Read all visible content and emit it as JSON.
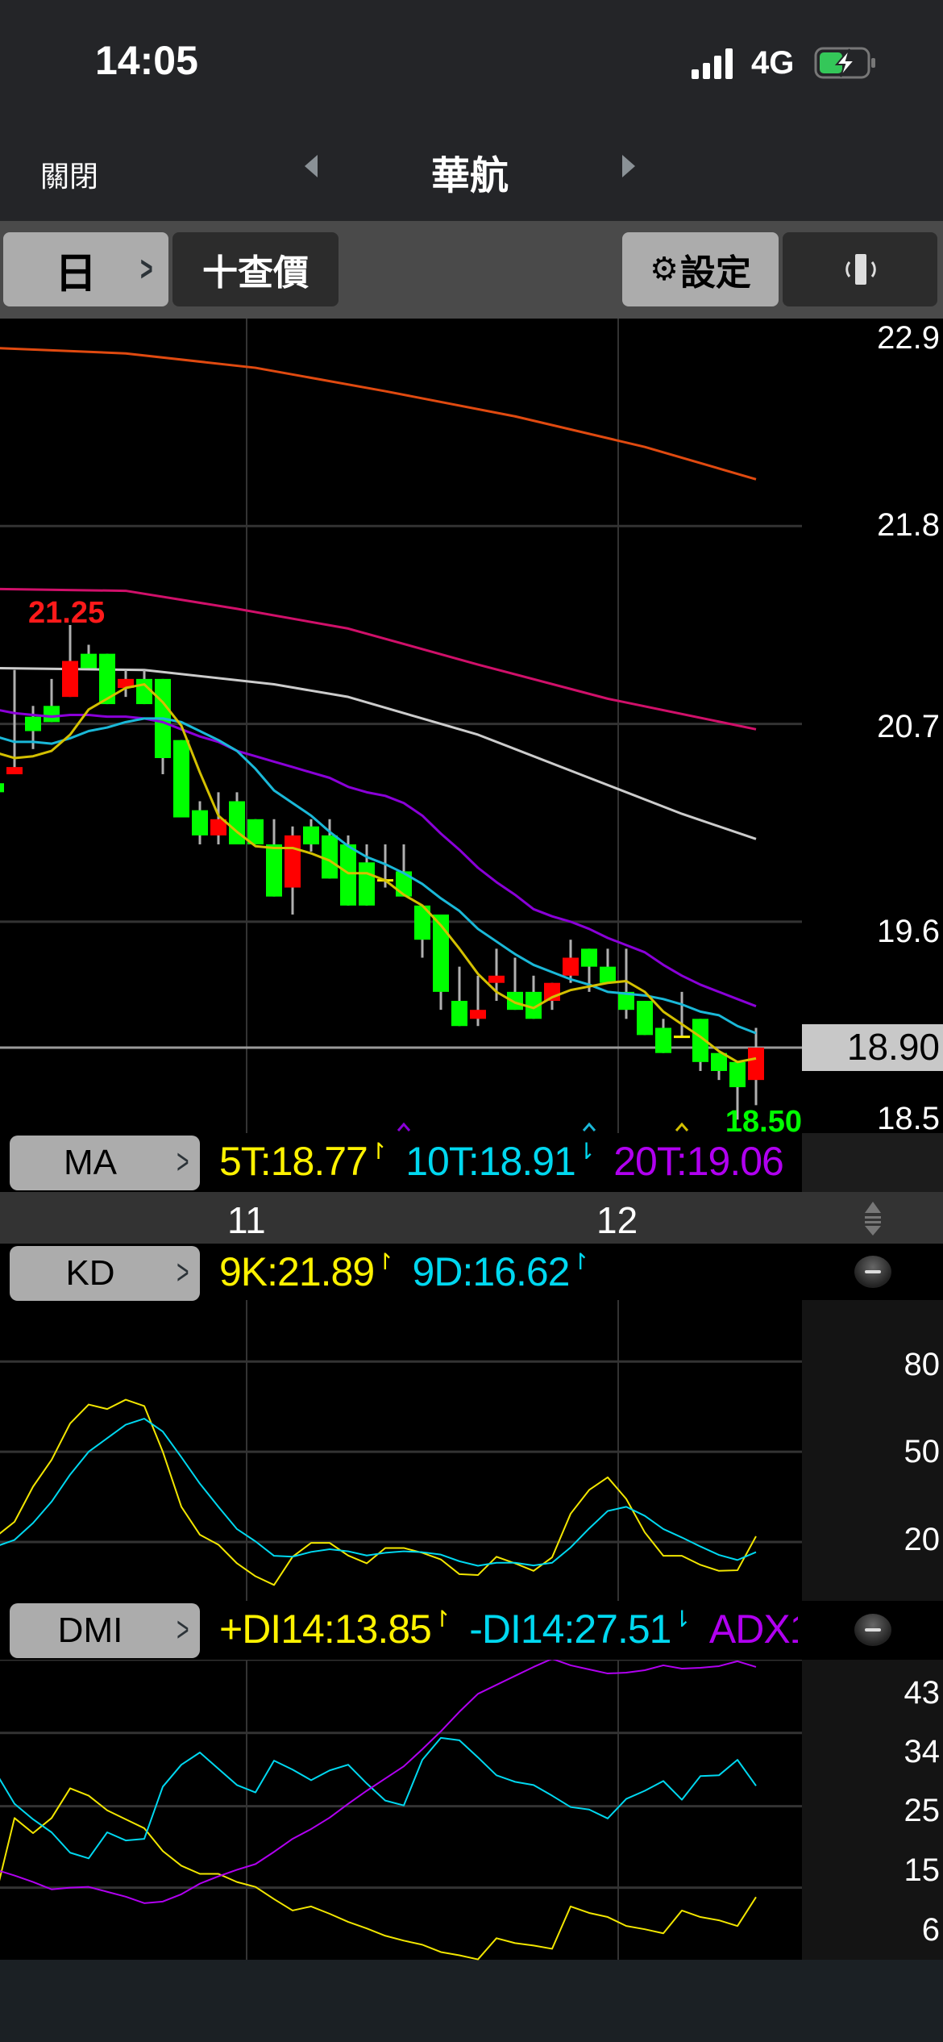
{
  "status_bar": {
    "time": "14:05",
    "network": "4G"
  },
  "nav": {
    "close": "關閉",
    "title": "華航"
  },
  "toolbar": {
    "period": "日",
    "quote": "十查價",
    "settings": "設定"
  },
  "price_axis": {
    "labels": [
      "22.9",
      "21.8",
      "20.7",
      "19.6",
      "18.5"
    ],
    "current": "18.90",
    "high_label": "21.25",
    "low_label": "18.50"
  },
  "ma_row": {
    "button": "MA",
    "ma5": "5T:18.77",
    "ma10": "10T:18.91",
    "ma20": "20T:19.06"
  },
  "date_axis": {
    "labels": [
      "11",
      "12"
    ]
  },
  "kd_row": {
    "button": "KD",
    "k": "9K:21.89",
    "d": "9D:16.62"
  },
  "kd_axis": {
    "labels": [
      "80",
      "50",
      "20"
    ]
  },
  "dmi_row": {
    "button": "DMI",
    "pdi": "+DI14:13.85",
    "mdi": "-DI14:27.51",
    "adx": "ADX1"
  },
  "dmi_axis": {
    "labels": [
      "43",
      "34",
      "25",
      "15",
      "6"
    ]
  },
  "colors": {
    "up": "#ff0000",
    "down": "#00ff00",
    "ma5": "#d4c000",
    "ma10": "#1ab8d8",
    "ma20": "#8a00d8",
    "ma_long1": "#cccccc",
    "ma_long2": "#d0106a",
    "ma_long3": "#e04a10",
    "k": "#f2e600",
    "d": "#00d8f0",
    "pdi": "#f2e600",
    "mdi": "#00d8f0",
    "adx": "#b000f0"
  },
  "chart_data": [
    {
      "type": "candlestick",
      "title": "華航 日線",
      "ylim": [
        18.4,
        22.96
      ],
      "yticks": [
        22.9,
        21.8,
        20.7,
        19.6,
        18.5
      ],
      "current_price": 18.9,
      "x_labels": [
        {
          "candle": 14,
          "label": "11"
        },
        {
          "candle": 34,
          "label": "12"
        }
      ],
      "ohlc": [
        [
          20.37,
          20.37,
          20.32,
          20.32
        ],
        [
          20.42,
          21.0,
          20.42,
          20.46
        ],
        [
          20.74,
          20.8,
          20.56,
          20.66
        ],
        [
          20.8,
          20.95,
          20.71,
          20.71
        ],
        [
          20.85,
          21.25,
          20.85,
          21.05
        ],
        [
          21.09,
          21.14,
          21.01,
          21.01
        ],
        [
          21.09,
          21.09,
          20.81,
          20.81
        ],
        [
          20.9,
          21.0,
          20.85,
          20.95
        ],
        [
          20.95,
          21.0,
          20.81,
          20.81
        ],
        [
          20.95,
          20.95,
          20.42,
          20.51
        ],
        [
          20.61,
          20.61,
          20.18,
          20.18
        ],
        [
          20.22,
          20.27,
          20.03,
          20.08
        ],
        [
          20.08,
          20.32,
          20.03,
          20.17
        ],
        [
          20.27,
          20.32,
          20.03,
          20.03
        ],
        [
          20.17,
          20.17,
          20.03,
          20.03
        ],
        [
          20.03,
          20.17,
          19.74,
          19.74
        ],
        [
          19.79,
          20.13,
          19.64,
          20.08
        ],
        [
          20.13,
          20.17,
          19.99,
          20.03
        ],
        [
          20.08,
          20.17,
          19.84,
          19.84
        ],
        [
          20.03,
          20.08,
          19.69,
          19.69
        ],
        [
          19.93,
          20.03,
          19.69,
          19.69
        ],
        [
          19.83,
          20.03,
          19.79,
          19.83
        ],
        [
          19.88,
          20.03,
          19.74,
          19.74
        ],
        [
          19.69,
          19.69,
          19.4,
          19.5
        ],
        [
          19.64,
          19.64,
          19.11,
          19.21
        ],
        [
          19.16,
          19.35,
          19.02,
          19.02
        ],
        [
          19.06,
          19.3,
          19.02,
          19.11
        ],
        [
          19.26,
          19.45,
          19.16,
          19.3
        ],
        [
          19.21,
          19.4,
          19.11,
          19.11
        ],
        [
          19.21,
          19.3,
          19.06,
          19.06
        ],
        [
          19.16,
          19.26,
          19.11,
          19.26
        ],
        [
          19.3,
          19.5,
          19.26,
          19.4
        ],
        [
          19.45,
          19.45,
          19.21,
          19.35
        ],
        [
          19.35,
          19.45,
          19.26,
          19.26
        ],
        [
          19.21,
          19.45,
          19.06,
          19.11
        ],
        [
          19.16,
          19.16,
          18.97,
          18.97
        ],
        [
          19.01,
          19.06,
          18.87,
          18.87
        ],
        [
          18.96,
          19.21,
          18.96,
          18.96
        ],
        [
          19.06,
          19.06,
          18.77,
          18.82
        ],
        [
          18.87,
          18.87,
          18.72,
          18.77
        ],
        [
          18.82,
          18.82,
          18.5,
          18.68
        ],
        [
          18.72,
          19.01,
          18.58,
          18.9
        ]
      ],
      "ma5": [
        20.54,
        20.51,
        20.52,
        20.55,
        20.64,
        20.78,
        20.84,
        20.9,
        20.92,
        20.82,
        20.69,
        20.43,
        20.19,
        20.1,
        20.02,
        20.01,
        20.01,
        19.98,
        19.94,
        19.87,
        19.87,
        19.83,
        19.75,
        19.69,
        19.58,
        19.45,
        19.31,
        19.21,
        19.15,
        19.12,
        19.18,
        19.22,
        19.24,
        19.26,
        19.27,
        19.21,
        19.1,
        19.03,
        18.96,
        18.88,
        18.82,
        18.84
      ],
      "ma10": [
        20.63,
        20.6,
        20.6,
        20.59,
        20.62,
        20.66,
        20.68,
        20.71,
        20.73,
        20.73,
        20.71,
        20.66,
        20.61,
        20.55,
        20.45,
        20.33,
        20.26,
        20.19,
        20.1,
        20.02,
        19.96,
        19.92,
        19.87,
        19.81,
        19.73,
        19.66,
        19.56,
        19.49,
        19.42,
        19.36,
        19.32,
        19.28,
        19.25,
        19.21,
        19.2,
        19.19,
        19.17,
        19.14,
        19.1,
        19.08,
        19.02,
        18.98
      ],
      "ma20": [
        20.78,
        20.76,
        20.75,
        20.74,
        20.75,
        20.75,
        20.74,
        20.74,
        20.73,
        20.71,
        20.67,
        20.63,
        20.6,
        20.55,
        20.52,
        20.49,
        20.46,
        20.43,
        20.4,
        20.35,
        20.32,
        20.3,
        20.26,
        20.19,
        20.09,
        20.0,
        19.9,
        19.82,
        19.75,
        19.67,
        19.63,
        19.6,
        19.56,
        19.51,
        19.47,
        19.43,
        19.36,
        19.3,
        19.25,
        19.21,
        19.17,
        19.13
      ],
      "long_ma": [
        {
          "color_key": "ma_long1",
          "points": [
            [
              1,
              21.01
            ],
            [
              9,
              21.0
            ],
            [
              16,
              20.92
            ],
            [
              20,
              20.85
            ],
            [
              27,
              20.64
            ],
            [
              33,
              20.4
            ],
            [
              38,
              20.2
            ],
            [
              42,
              20.06
            ]
          ]
        },
        {
          "color_key": "ma_long2",
          "points": [
            [
              1,
              21.45
            ],
            [
              8,
              21.44
            ],
            [
              14,
              21.34
            ],
            [
              20,
              21.23
            ],
            [
              27,
              21.03
            ],
            [
              34,
              20.84
            ],
            [
              42,
              20.67
            ]
          ]
        },
        {
          "color_key": "ma_long3",
          "points": [
            [
              1,
              22.79
            ],
            [
              8,
              22.76
            ],
            [
              15,
              22.68
            ],
            [
              22,
              22.55
            ],
            [
              29,
              22.41
            ],
            [
              36,
              22.24
            ],
            [
              42,
              22.06
            ]
          ]
        }
      ],
      "markers": [
        {
          "candle": 23,
          "color_key": "ma20"
        },
        {
          "candle": 33,
          "color_key": "ma10"
        },
        {
          "candle": 38,
          "color_key": "ma5"
        }
      ]
    },
    {
      "type": "line",
      "title": "KD",
      "yticks": [
        80,
        50,
        20
      ],
      "series": [
        {
          "name": "9K",
          "color_key": "k",
          "values": [
            21.8,
            26.7,
            38.4,
            47.3,
            59.4,
            65.7,
            64.2,
            67.3,
            65.2,
            50.0,
            31.7,
            22.4,
            19.1,
            12.9,
            8.6,
            5.7,
            15.1,
            19.7,
            19.7,
            15.5,
            12.9,
            18.0,
            18.0,
            16.4,
            14.2,
            9.3,
            9.0,
            15.1,
            12.9,
            10.4,
            14.9,
            29.4,
            37.3,
            41.5,
            34.3,
            23.2,
            15.4,
            15.4,
            12.4,
            10.4,
            10.6,
            21.89
          ]
        },
        {
          "name": "9D",
          "color_key": "d",
          "values": [
            18.5,
            20.7,
            26.3,
            33.4,
            42.4,
            50.0,
            54.5,
            59.0,
            61.0,
            56.7,
            48.2,
            39.4,
            31.7,
            24.3,
            20.2,
            15.4,
            15.1,
            16.7,
            17.6,
            16.9,
            15.5,
            16.4,
            16.9,
            16.6,
            15.8,
            13.6,
            12.1,
            13.1,
            13.1,
            12.2,
            13.1,
            18.2,
            24.5,
            30.3,
            31.7,
            28.7,
            24.3,
            21.5,
            18.5,
            15.7,
            14.0,
            16.62
          ]
        }
      ]
    },
    {
      "type": "line",
      "title": "DMI",
      "yticks": [
        43,
        34,
        25,
        15,
        6
      ],
      "series": [
        {
          "name": "+DI14",
          "color_key": "pdi",
          "values": [
            14.2,
            23.55,
            21.7,
            23.55,
            27.2,
            26.3,
            24.5,
            23.4,
            22.3,
            19.5,
            17.7,
            16.7,
            16.7,
            15.7,
            15.1,
            13.6,
            12.2,
            12.7,
            11.8,
            10.8,
            10.0,
            9.1,
            8.5,
            8.0,
            7.1,
            6.7,
            6.2,
            8.8,
            8.2,
            7.9,
            7.5,
            12.7,
            11.9,
            11.4,
            10.3,
            9.9,
            9.4,
            12.2,
            11.4,
            11.0,
            10.3,
            13.85
          ]
        },
        {
          "name": "-DI14",
          "color_key": "mdi",
          "values": [
            29.1,
            25.3,
            23.4,
            21.8,
            19.3,
            18.6,
            21.8,
            20.8,
            21.0,
            27.4,
            30.1,
            31.6,
            29.6,
            27.6,
            26.7,
            30.6,
            29.5,
            28.2,
            29.4,
            30.1,
            27.8,
            25.7,
            25.1,
            30.7,
            33.4,
            33.1,
            31.0,
            28.8,
            28.0,
            27.6,
            26.3,
            24.9,
            24.6,
            23.5,
            25.9,
            26.9,
            28.1,
            25.8,
            28.7,
            28.8,
            30.7,
            27.51
          ]
        },
        {
          "name": "ADX",
          "color_key": "adx",
          "values": [
            17.2,
            16.5,
            15.7,
            14.8,
            15.0,
            15.1,
            14.5,
            13.9,
            13.1,
            13.3,
            14.2,
            15.5,
            16.4,
            17.2,
            17.9,
            19.4,
            21.0,
            22.2,
            23.6,
            25.3,
            26.9,
            28.4,
            29.9,
            32.0,
            34.2,
            36.6,
            38.8,
            39.9,
            41.0,
            42.1,
            43.1,
            42.3,
            41.8,
            41.3,
            41.4,
            41.7,
            42.3,
            41.9,
            42.0,
            42.2,
            42.8,
            42.1
          ]
        }
      ]
    }
  ]
}
